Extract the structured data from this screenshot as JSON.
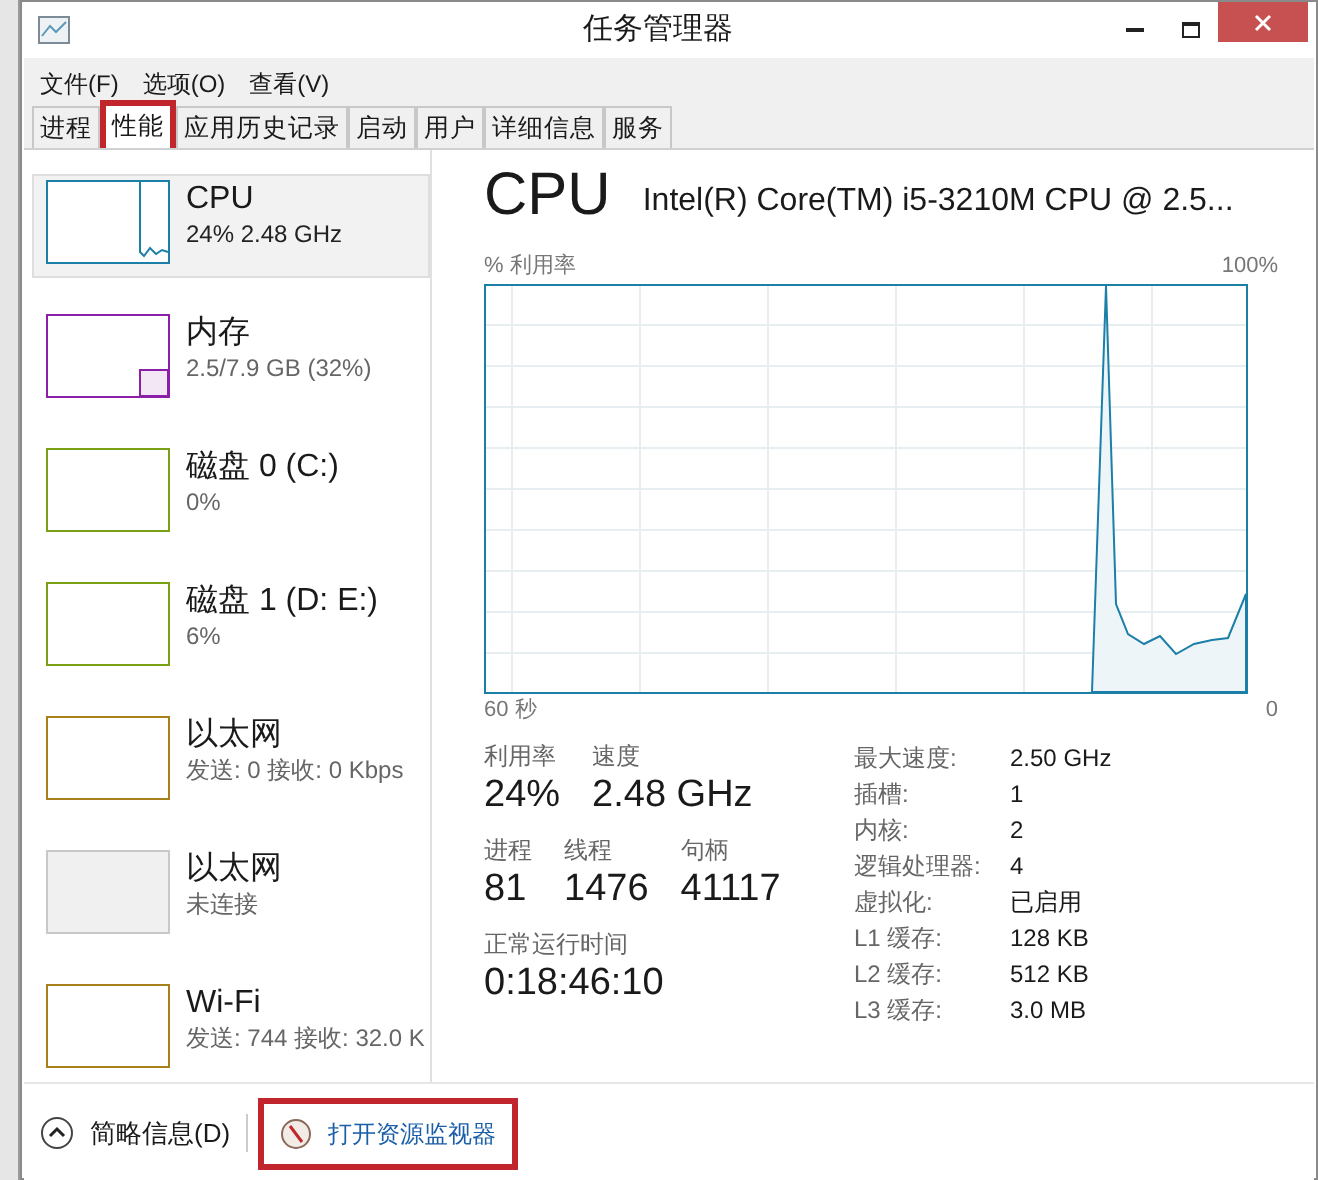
{
  "window": {
    "title": "任务管理器"
  },
  "menu": [
    "文件(F)",
    "选项(O)",
    "查看(V)"
  ],
  "tabs": [
    {
      "label": "进程",
      "selected": false,
      "highlighted": false
    },
    {
      "label": "性能",
      "selected": true,
      "highlighted": true
    },
    {
      "label": "应用历史记录",
      "selected": false,
      "highlighted": false
    },
    {
      "label": "启动",
      "selected": false,
      "highlighted": false
    },
    {
      "label": "用户",
      "selected": false,
      "highlighted": false
    },
    {
      "label": "详细信息",
      "selected": false,
      "highlighted": false
    },
    {
      "label": "服务",
      "selected": false,
      "highlighted": false
    }
  ],
  "sidebar": {
    "items": [
      {
        "name": "CPU",
        "detail": "24% 2.48 GHz",
        "selected": true,
        "color": "#1b7fa8",
        "connected": true
      },
      {
        "name": "内存",
        "detail": "2.5/7.9 GB (32%)",
        "selected": false,
        "color": "#8b1fa8",
        "connected": true
      },
      {
        "name": "磁盘 0 (C:)",
        "detail": "0%",
        "selected": false,
        "color": "#7aa116",
        "connected": true
      },
      {
        "name": "磁盘 1 (D: E:)",
        "detail": "6%",
        "selected": false,
        "color": "#7aa116",
        "connected": true
      },
      {
        "name": "以太网",
        "detail": "发送: 0 接收: 0 Kbps",
        "selected": false,
        "color": "#a77f1b",
        "connected": true
      },
      {
        "name": "以太网",
        "detail": "未连接",
        "selected": false,
        "connected": false
      },
      {
        "name": "Wi-Fi",
        "detail": "发送: 744 接收: 32.0 K",
        "selected": false,
        "color": "#a77f1b",
        "connected": true
      }
    ]
  },
  "panel": {
    "title": "CPU",
    "model": "Intel(R) Core(TM) i5-3210M CPU @ 2.5...",
    "graph_label": "% 利用率",
    "graph_max": "100%",
    "graph_start": "60 秒",
    "graph_end": "0",
    "metrics": [
      [
        {
          "label": "利用率",
          "value": "24%"
        },
        {
          "label": "速度",
          "value": "2.48 GHz"
        }
      ],
      [
        {
          "label": "进程",
          "value": "81"
        },
        {
          "label": "线程",
          "value": "1476"
        },
        {
          "label": "句柄",
          "value": "41117"
        }
      ],
      [
        {
          "label": "正常运行时间",
          "value": "0:18:46:10"
        }
      ]
    ],
    "specs": [
      {
        "label": "最大速度:",
        "value": "2.50 GHz"
      },
      {
        "label": "插槽:",
        "value": "1"
      },
      {
        "label": "内核:",
        "value": "2"
      },
      {
        "label": "逻辑处理器:",
        "value": "4"
      },
      {
        "label": "虚拟化:",
        "value": "已启用"
      },
      {
        "label": "L1 缓存:",
        "value": "128 KB"
      },
      {
        "label": "L2 缓存:",
        "value": "512 KB"
      },
      {
        "label": "L3 缓存:",
        "value": "3.0 MB"
      }
    ]
  },
  "footer": {
    "summary": "简略信息(D)",
    "monitor": {
      "label": "打开资源监视器",
      "highlighted": true
    }
  }
}
